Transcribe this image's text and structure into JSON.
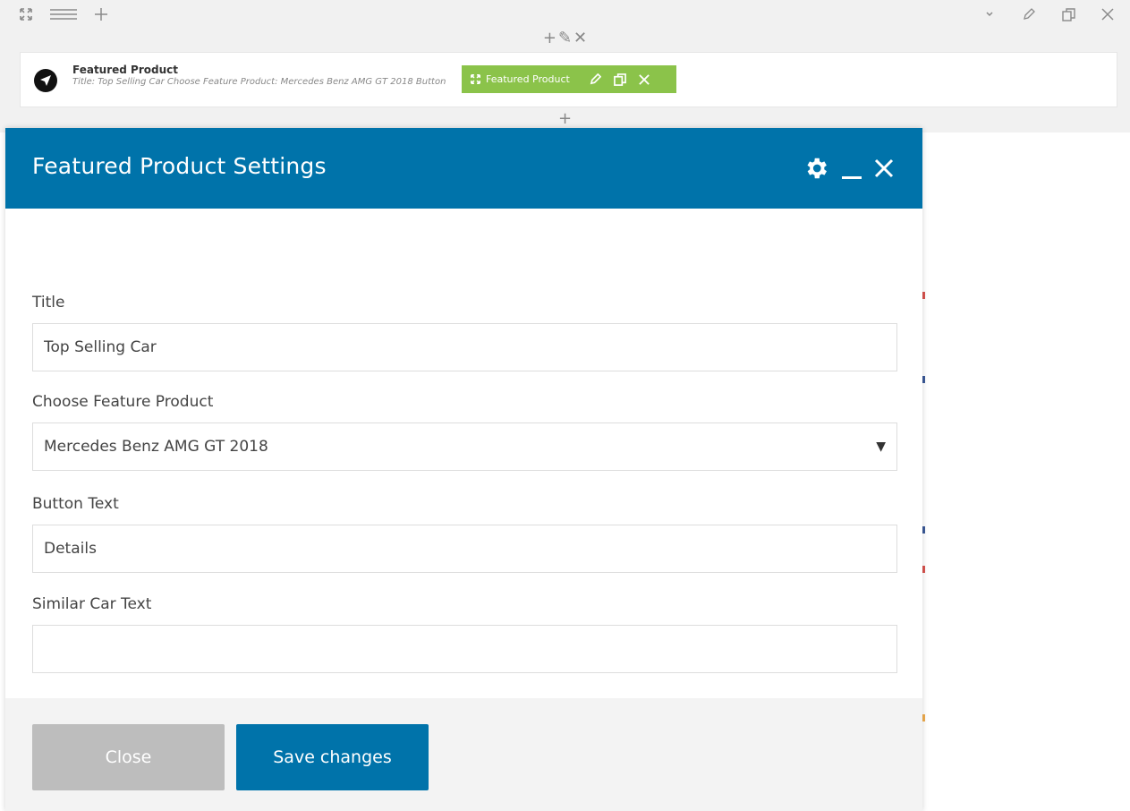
{
  "toolbar": {
    "left_icons": [
      "expand-icon",
      "menu-icon",
      "plus-icon"
    ],
    "right_icons": [
      "chevron-down-icon",
      "pencil-icon",
      "clone-icon",
      "close-icon"
    ],
    "row_controls": [
      "+",
      "✎",
      "✕"
    ],
    "add_below": "+"
  },
  "element": {
    "icon": "navigation-arrow-icon",
    "title": "Featured Product",
    "description": "Title: Top Selling Car  Choose Feature Product: Mercedes Benz AMG GT 2018  Button",
    "badge": {
      "label": "Featured Product",
      "color": "#8bc34a"
    }
  },
  "modal": {
    "title": "Featured Product Settings",
    "header_color": "#0073aa",
    "header_icons": [
      "gear-icon",
      "minimize-icon",
      "close-icon"
    ],
    "fields": {
      "title": {
        "label": "Title",
        "value": "Top Selling Car"
      },
      "feature_product": {
        "label": "Choose Feature Product",
        "value": "Mercedes Benz AMG GT 2018"
      },
      "button_text": {
        "label": "Button Text",
        "value": "Details"
      },
      "similar_car_text": {
        "label": "Similar Car Text",
        "value": ""
      }
    },
    "buttons": {
      "close": "Close",
      "save": "Save changes"
    }
  }
}
